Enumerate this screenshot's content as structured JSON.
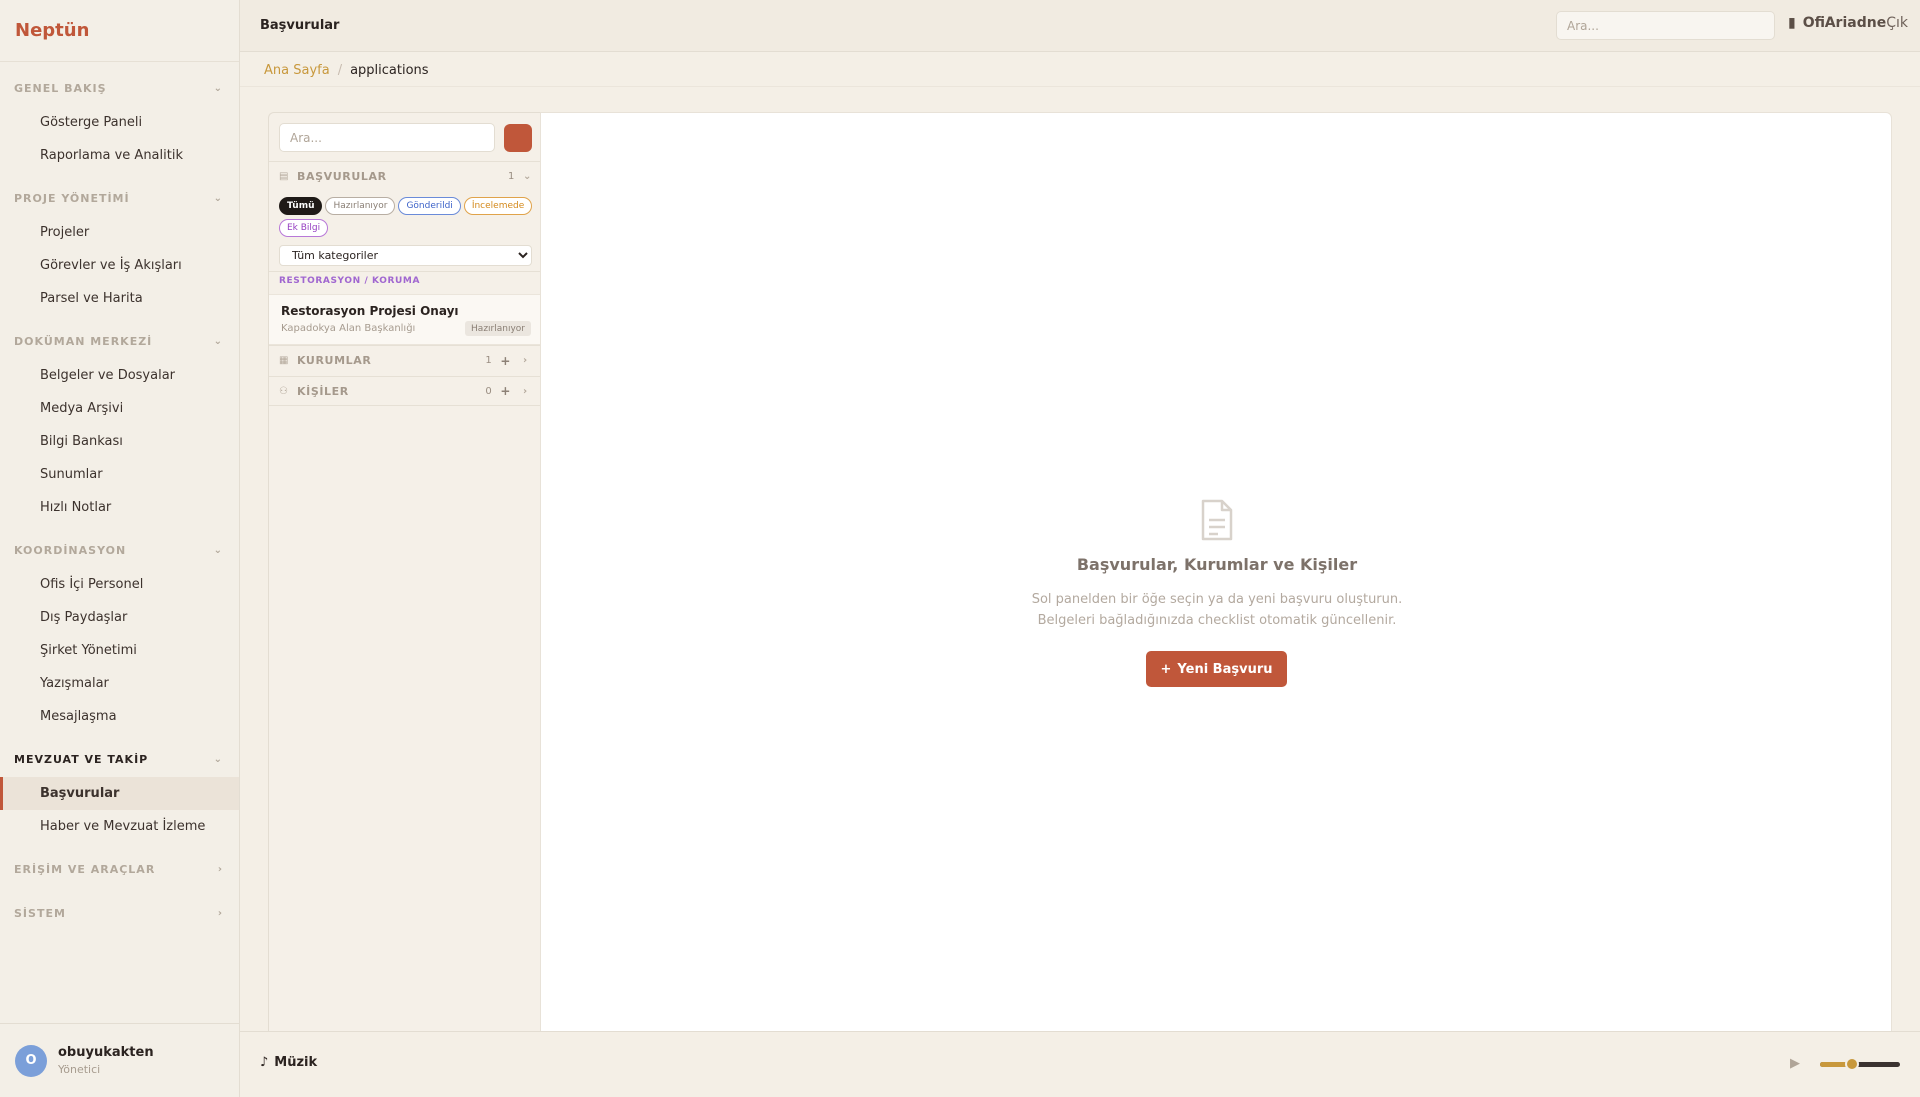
{
  "brand": "Neptün",
  "sidebar": {
    "sections": [
      {
        "title": "GENEL BAKIŞ",
        "chevron": "⌄",
        "active": false,
        "items": [
          "Gösterge Paneli",
          "Raporlama ve Analitik"
        ]
      },
      {
        "title": "PROJE YÖNETİMİ",
        "chevron": "⌄",
        "active": false,
        "items": [
          "Projeler",
          "Görevler ve İş Akışları",
          "Parsel ve Harita"
        ]
      },
      {
        "title": "DOKÜMAN MERKEZİ",
        "chevron": "⌄",
        "active": false,
        "items": [
          "Belgeler ve Dosyalar",
          "Medya Arşivi",
          "Bilgi Bankası",
          "Sunumlar",
          "Hızlı Notlar"
        ]
      },
      {
        "title": "KOORDİNASYON",
        "chevron": "⌄",
        "active": false,
        "items": [
          "Ofis İçi Personel",
          "Dış Paydaşlar",
          "Şirket Yönetimi",
          "Yazışmalar",
          "Mesajlaşma"
        ]
      },
      {
        "title": "MEVZUAT VE TAKİP",
        "chevron": "⌄",
        "active": true,
        "items": [
          "Başvurular",
          "Haber ve Mevzuat İzleme"
        ]
      },
      {
        "title": "ERİŞİM VE ARAÇLAR",
        "chevron": "›",
        "active": false,
        "items": []
      },
      {
        "title": "SİSTEM",
        "chevron": "›",
        "active": false,
        "items": []
      }
    ],
    "active_item": "Başvurular"
  },
  "user": {
    "initial": "O",
    "name": "obuyukakten",
    "role": "Yönetici"
  },
  "header": {
    "title": "Başvurular",
    "search_placeholder": "Ara...",
    "office_label": "Ofis",
    "user_label": "Ariadne",
    "logout_label": "Çık"
  },
  "breadcrumb": {
    "home": "Ana Sayfa",
    "separator": "/",
    "current": "applications"
  },
  "panel": {
    "search_placeholder": "Ara...",
    "applications": {
      "label": "BAŞVURULAR",
      "count": "1"
    },
    "chips": [
      "Tümü",
      "Hazırlanıyor",
      "Gönderildi",
      "İncelemede",
      "Ek Bilgi"
    ],
    "category_select": "Tüm kategoriler",
    "category_label": "RESTORASYON / KORUMA",
    "item": {
      "title": "Restorasyon Projesi Onayı",
      "subtitle": "Kapadokya Alan Başkanlığı",
      "status": "Hazırlanıyor"
    },
    "institutions": {
      "label": "KURUMLAR",
      "count": "1"
    },
    "people": {
      "label": "KİŞİLER",
      "count": "0"
    }
  },
  "empty_state": {
    "title": "Başvurular, Kurumlar ve Kişiler",
    "line1": "Sol panelden bir öğe seçin ya da yeni başvuru oluşturun.",
    "line2": "Belgeleri bağladığınızda checklist otomatik güncellenir.",
    "button": "Yeni Başvuru"
  },
  "music": {
    "label": "Müzik",
    "volume": 0.4
  },
  "colors": {
    "accent": "#c0573a",
    "gold": "#c8983c"
  }
}
